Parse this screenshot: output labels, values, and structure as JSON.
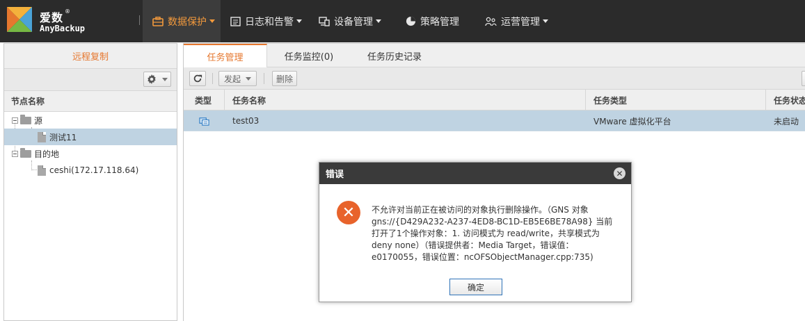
{
  "brand": {
    "name_cn": "爱数",
    "registered": "®",
    "name_en": "AnyBackup"
  },
  "nav": [
    {
      "label": "数据保护",
      "icon": "briefcase-icon",
      "active": true,
      "dropdown": true
    },
    {
      "label": "日志和告警",
      "icon": "log-icon",
      "active": false,
      "dropdown": true
    },
    {
      "label": "设备管理",
      "icon": "device-icon",
      "active": false,
      "dropdown": true
    },
    {
      "label": "策略管理",
      "icon": "pie-icon",
      "active": false,
      "dropdown": false
    },
    {
      "label": "运营管理",
      "icon": "users-icon",
      "active": false,
      "dropdown": true
    }
  ],
  "sidebar": {
    "header": "远程复制",
    "column": "节点名称",
    "tree": [
      {
        "label": "源",
        "type": "folder"
      },
      {
        "label": "测试11",
        "type": "file",
        "selected": true
      },
      {
        "label": "目的地",
        "type": "folder"
      },
      {
        "label": "ceshi(172.17.118.64)",
        "type": "file"
      }
    ]
  },
  "tabs": [
    {
      "label": "任务管理",
      "active": true
    },
    {
      "label": "任务监控(0)",
      "active": false
    },
    {
      "label": "任务历史记录",
      "active": false
    }
  ],
  "toolbar": {
    "refresh_icon": "refresh-icon",
    "start_label": "发起",
    "delete_label": "删除"
  },
  "grid": {
    "columns": [
      "类型",
      "任务名称",
      "任务类型",
      "任务状态"
    ],
    "rows": [
      {
        "type_icon": "vm-icon",
        "name": "test03",
        "task_type": "VMware 虚拟化平台",
        "status": "未启动"
      }
    ]
  },
  "dialog": {
    "title": "错误",
    "message": "不允许对当前正在被访问的对象执行删除操作。（GNS 对象gns://{D429A232-A237-4ED8-BC1D-EB5E6BE78A98} 当前打开了1个操作对象：1. 访问模式为 read/write，共享模式为deny none）（错误提供者：Media Target，错误值：e0170055，错误位置：ncOFSObjectManager.cpp:735)",
    "ok_label": "确定"
  },
  "colors": {
    "accent": "#e6772e",
    "nav_bg": "#2b2b2b",
    "selection": "#bfd3e2",
    "error": "#e8632b"
  }
}
